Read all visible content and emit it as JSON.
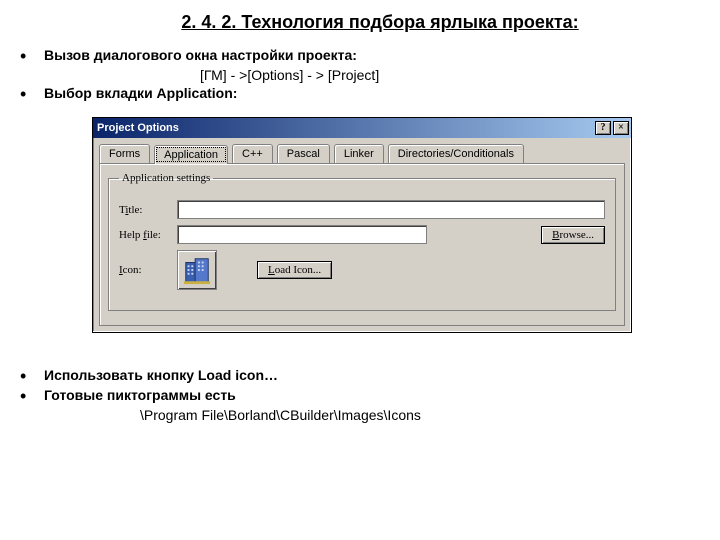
{
  "heading": "2. 4. 2. Технология подбора ярлыка проекта:",
  "bullets": {
    "b1": "Вызов диалогового окна настройки проекта:",
    "b1_path": "[ГМ] - >[Options]  - > [Project]",
    "b2": "Выбор вкладки Application:",
    "b3": "Использовать кнопку Load icon…",
    "b4": "Готовые пиктограммы есть",
    "b4_path": "\\Program File\\Borland\\CBuilder\\Images\\Icons"
  },
  "dialog": {
    "title": "Project Options",
    "close": "×",
    "help": "?",
    "tabs": [
      "Forms",
      "Application",
      "C++",
      "Pascal",
      "Linker",
      "Directories/Conditionals"
    ],
    "group": "Application settings",
    "title_label_pre": "T",
    "title_label_uchar": "i",
    "title_label_post": "tle:",
    "title_value": "",
    "help_label_pre": "Help ",
    "help_label_uchar": "f",
    "help_label_post": "ile:",
    "help_value": "",
    "browse_pre": "",
    "browse_u": "B",
    "browse_post": "rowse...",
    "icon_label_pre": "",
    "icon_label_u": "I",
    "icon_label_post": "con:",
    "load_pre": "",
    "load_u": "L",
    "load_post": "oad Icon..."
  }
}
